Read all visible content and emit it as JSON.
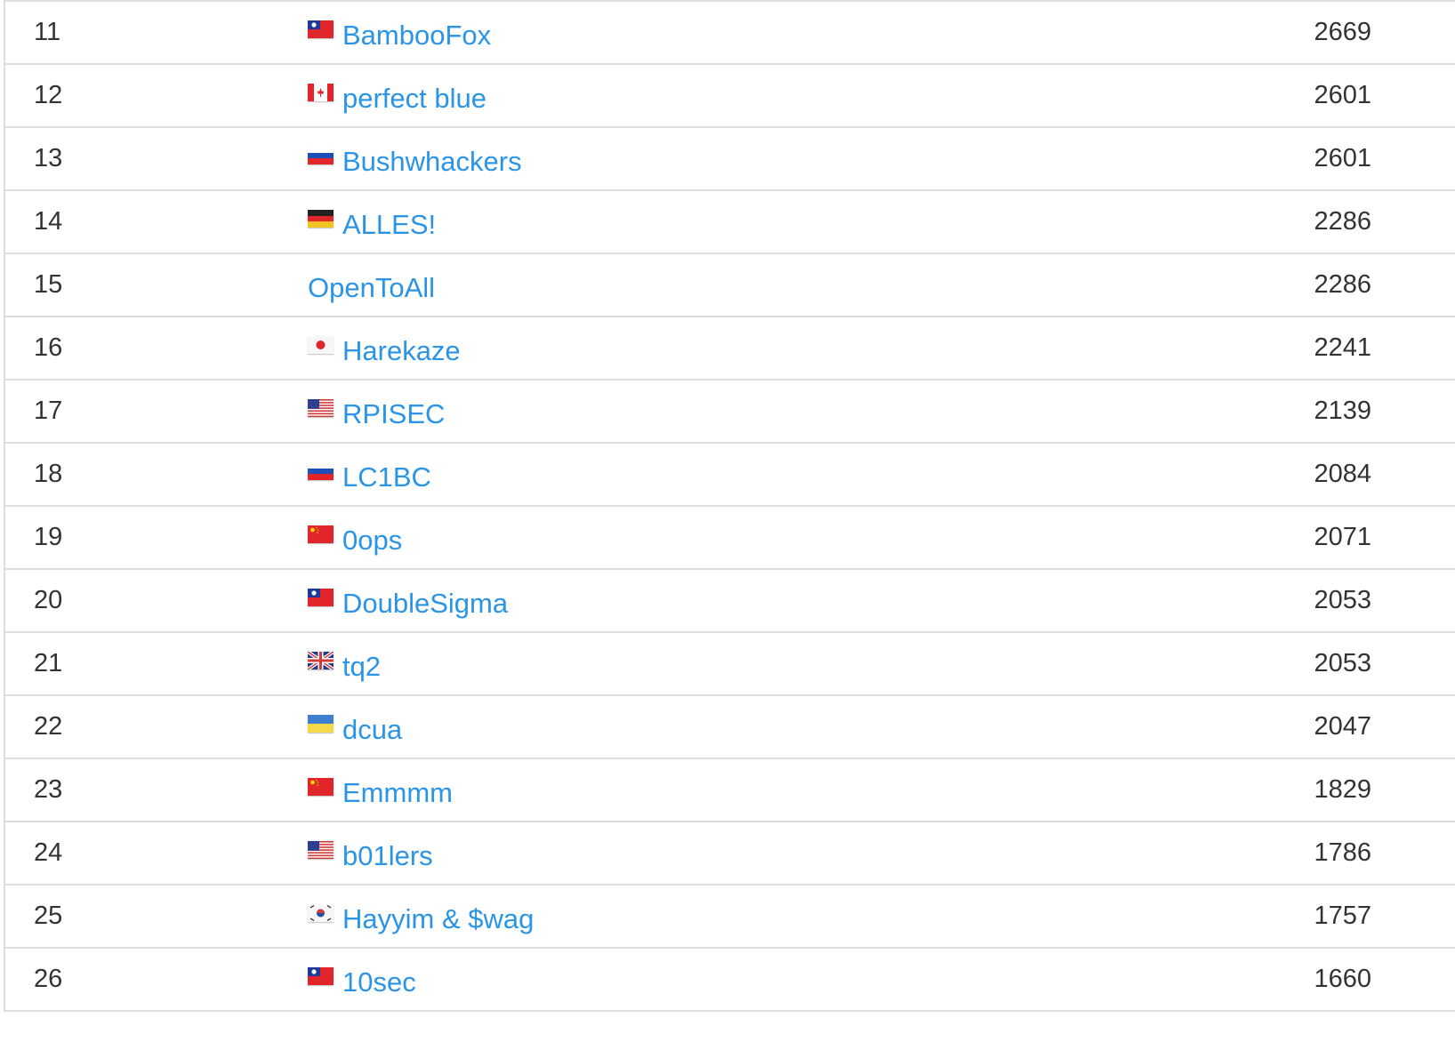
{
  "scoreboard": {
    "rows": [
      {
        "rank": "11",
        "team": "BambooFox",
        "score": "2669",
        "flag": "tw-flag-icon"
      },
      {
        "rank": "12",
        "team": "perfect blue",
        "score": "2601",
        "flag": "ca-flag-icon"
      },
      {
        "rank": "13",
        "team": "Bushwhackers",
        "score": "2601",
        "flag": "ru-flag-icon"
      },
      {
        "rank": "14",
        "team": "ALLES!",
        "score": "2286",
        "flag": "de-flag-icon"
      },
      {
        "rank": "15",
        "team": "OpenToAll",
        "score": "2286",
        "flag": ""
      },
      {
        "rank": "16",
        "team": "Harekaze",
        "score": "2241",
        "flag": "jp-flag-icon"
      },
      {
        "rank": "17",
        "team": "RPISEC",
        "score": "2139",
        "flag": "us-flag-icon"
      },
      {
        "rank": "18",
        "team": "LC1BC",
        "score": "2084",
        "flag": "ru-flag-icon"
      },
      {
        "rank": "19",
        "team": "0ops",
        "score": "2071",
        "flag": "cn-flag-icon"
      },
      {
        "rank": "20",
        "team": "DoubleSigma",
        "score": "2053",
        "flag": "tw-flag-icon"
      },
      {
        "rank": "21",
        "team": "tq2",
        "score": "2053",
        "flag": "gb-flag-icon"
      },
      {
        "rank": "22",
        "team": "dcua",
        "score": "2047",
        "flag": "ua-flag-icon"
      },
      {
        "rank": "23",
        "team": "Emmmm",
        "score": "1829",
        "flag": "cn-flag-icon"
      },
      {
        "rank": "24",
        "team": "b01lers",
        "score": "1786",
        "flag": "us-flag-icon"
      },
      {
        "rank": "25",
        "team": "Hayyim & $wag",
        "score": "1757",
        "flag": "kr-flag-icon"
      },
      {
        "rank": "26",
        "team": "10sec",
        "score": "1660",
        "flag": "tw-flag-icon"
      }
    ]
  },
  "colors": {
    "link": "#2a94e6",
    "text": "#333333",
    "border": "#dddddd"
  }
}
